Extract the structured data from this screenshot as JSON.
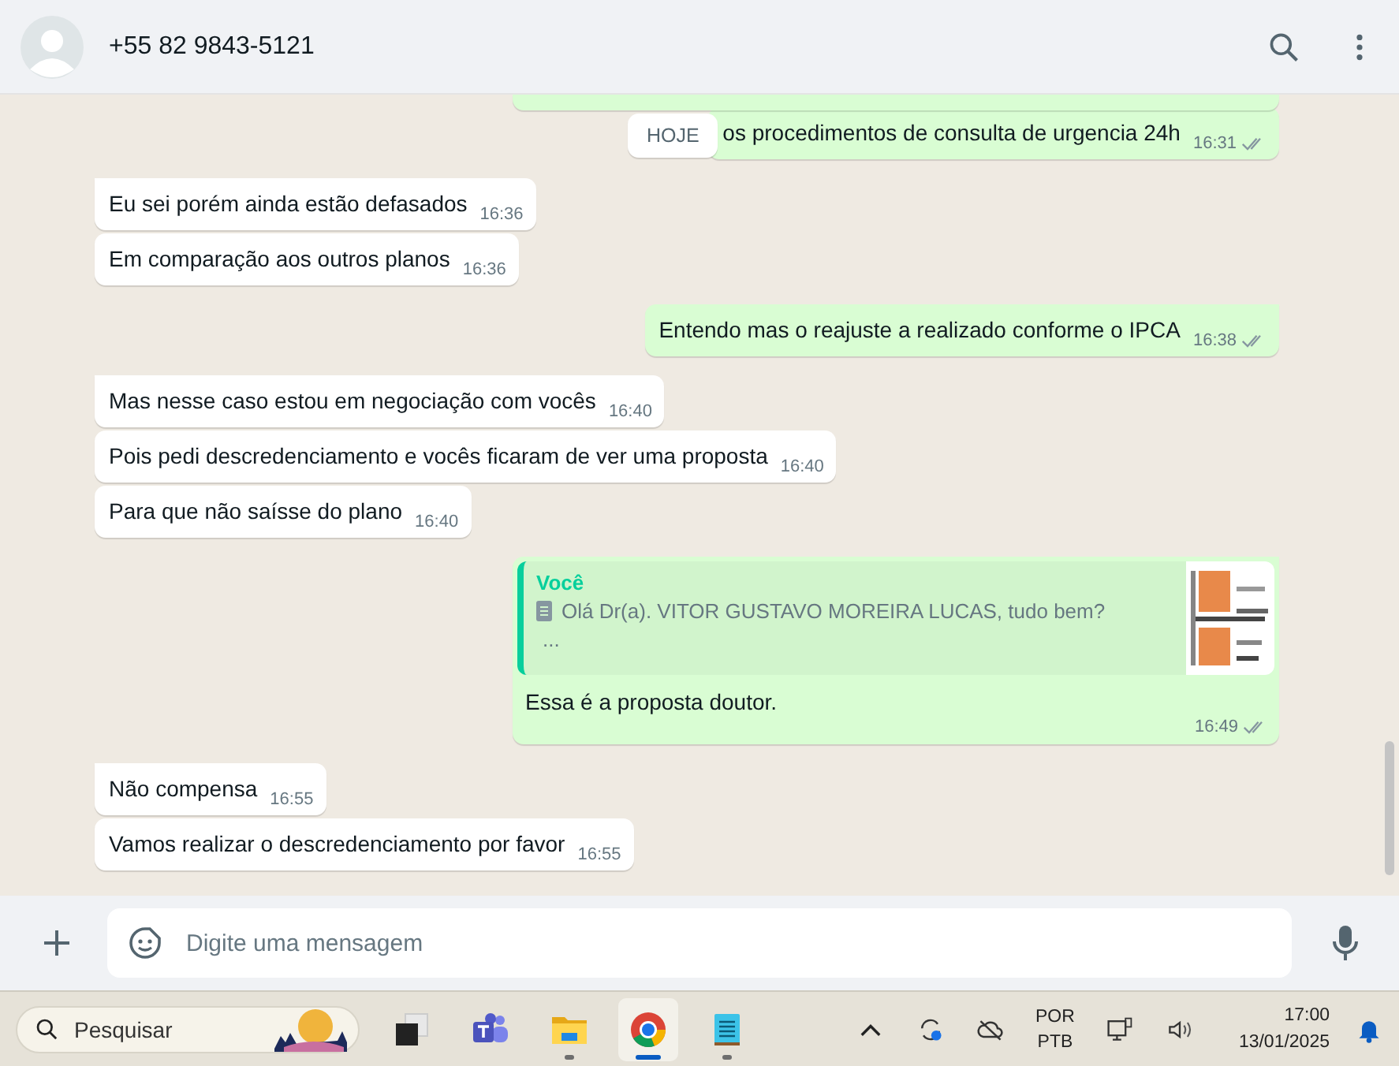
{
  "header": {
    "contact": "+55 82 9843-5121"
  },
  "date_chip": "HOJE",
  "messages": [
    {
      "kind": "text",
      "outgoing": true,
      "text": "os procedimentos de consulta de urgencia 24h",
      "time": "16:31",
      "read": false,
      "tail": false
    },
    {
      "kind": "text",
      "outgoing": false,
      "text": "Eu sei porém ainda estão defasados",
      "time": "16:36",
      "tail": true
    },
    {
      "kind": "text",
      "outgoing": false,
      "text": "Em comparação aos outros planos",
      "time": "16:36",
      "tail": false
    },
    {
      "kind": "text",
      "outgoing": true,
      "text": "Entendo mas o reajuste a realizado conforme o IPCA",
      "time": "16:38",
      "read": false,
      "tail": true
    },
    {
      "kind": "text",
      "outgoing": false,
      "text": "Mas nesse caso estou em negociação com vocês",
      "time": "16:40",
      "tail": true
    },
    {
      "kind": "text",
      "outgoing": false,
      "text": "Pois pedi descredenciamento e vocês ficaram de ver uma proposta",
      "time": "16:40",
      "tail": false
    },
    {
      "kind": "text",
      "outgoing": false,
      "text": "Para que não saísse do plano",
      "time": "16:40",
      "tail": false
    },
    {
      "kind": "quote",
      "outgoing": true,
      "quote_author": "Você",
      "quote_text": "Olá Dr(a). VITOR GUSTAVO MOREIRA LUCAS, tudo bem?",
      "quote_more": "...",
      "text": "Essa é a proposta doutor.",
      "time": "16:49",
      "read": false,
      "tail": true
    },
    {
      "kind": "text",
      "outgoing": false,
      "text": "Não compensa",
      "time": "16:55",
      "tail": true
    },
    {
      "kind": "text",
      "outgoing": false,
      "text": "Vamos realizar o descredenciamento por favor",
      "time": "16:55",
      "tail": false
    }
  ],
  "composer": {
    "placeholder": "Digite uma mensagem"
  },
  "taskbar": {
    "search_placeholder": "Pesquisar",
    "apps": [
      {
        "kind": "desktop",
        "selected": false,
        "running": false
      },
      {
        "kind": "teams",
        "selected": false,
        "running": false
      },
      {
        "kind": "folder",
        "selected": false,
        "running": true
      },
      {
        "kind": "browser",
        "selected": true,
        "running": true
      },
      {
        "kind": "notepad",
        "selected": false,
        "running": true
      }
    ],
    "lang_top": "POR",
    "lang_bottom": "PTB",
    "time": "17:00",
    "date": "13/01/2025"
  }
}
